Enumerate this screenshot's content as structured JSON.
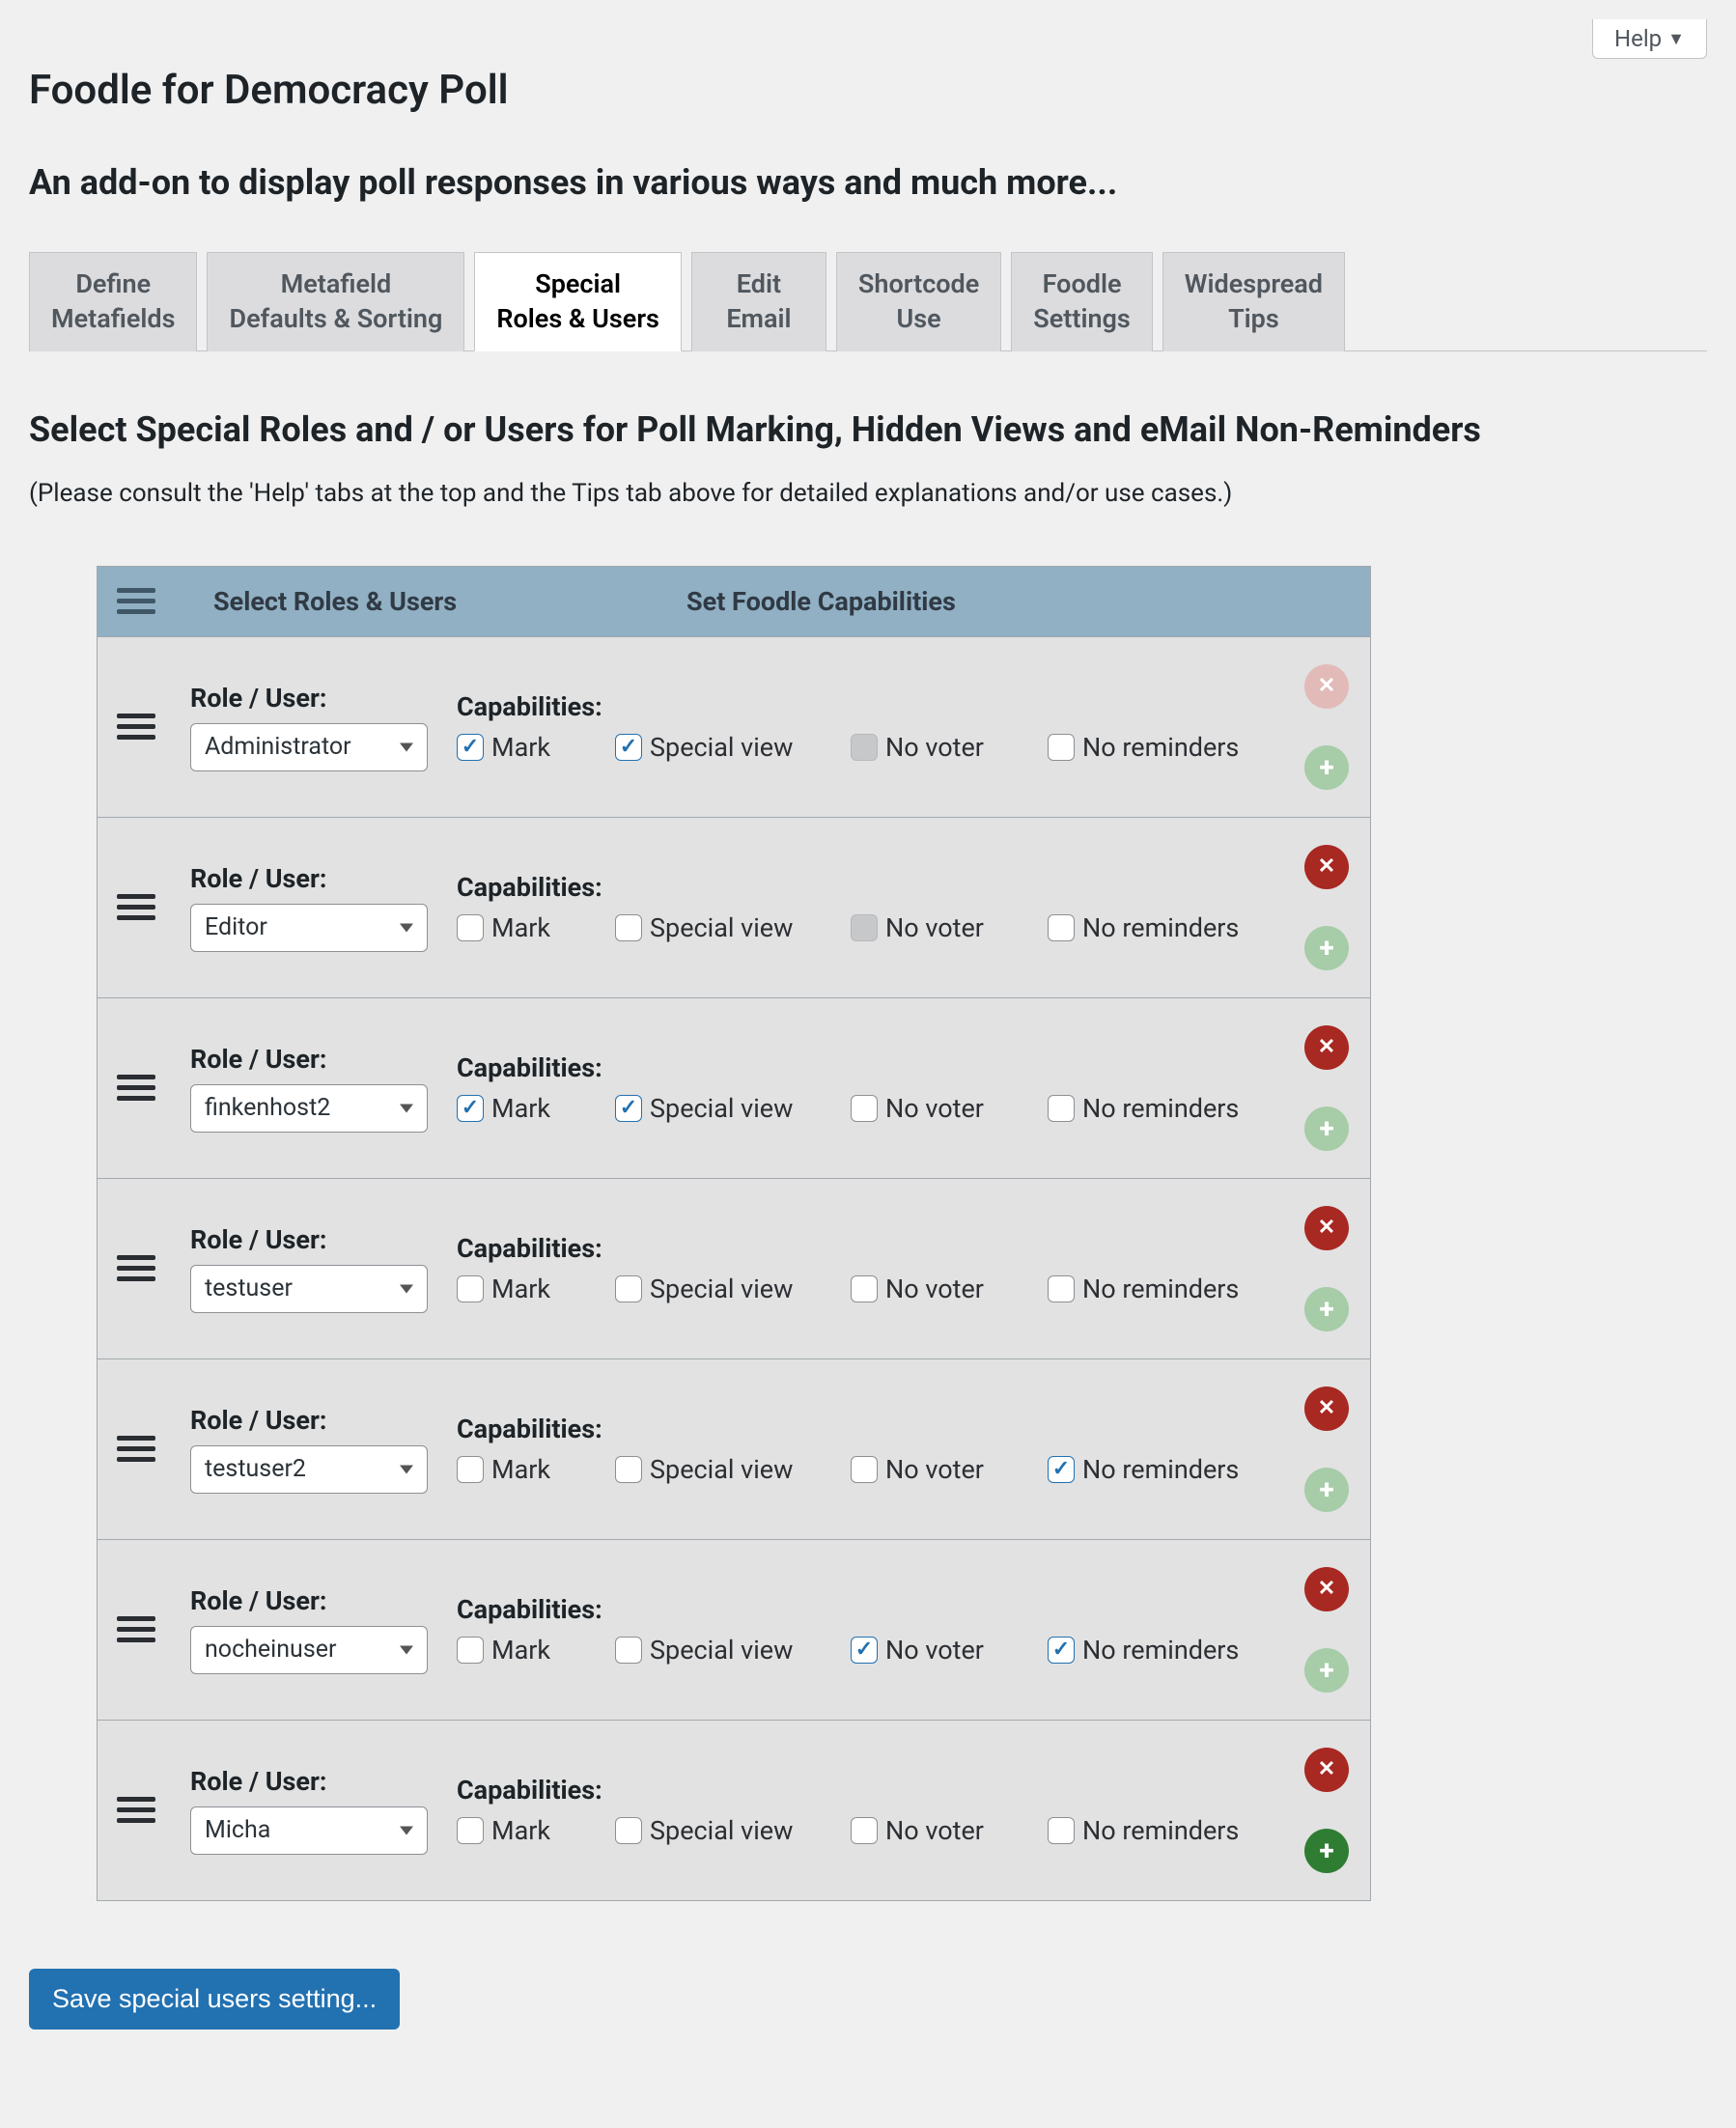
{
  "help": {
    "label": "Help"
  },
  "page": {
    "title": "Foodle for Democracy Poll",
    "subtitle": "An add-on to display poll responses in various ways and much more..."
  },
  "tabs": [
    {
      "lines": [
        "Define",
        "Metafields"
      ],
      "active": false
    },
    {
      "lines": [
        "Metafield",
        "Defaults & Sorting"
      ],
      "active": false
    },
    {
      "lines": [
        "Special",
        "Roles & Users"
      ],
      "active": true
    },
    {
      "lines": [
        "Edit",
        "Email"
      ],
      "active": false
    },
    {
      "lines": [
        "Shortcode",
        "Use"
      ],
      "active": false
    },
    {
      "lines": [
        "Foodle",
        "Settings"
      ],
      "active": false
    },
    {
      "lines": [
        "Widespread",
        "Tips"
      ],
      "active": false
    }
  ],
  "section": {
    "title": "Select Special Roles and / or Users for Poll Marking, Hidden Views and eMail Non-Reminders",
    "note": "(Please consult the 'Help' tabs at the top and the Tips tab above for detailed explanations and/or use cases.)"
  },
  "tableHead": {
    "col1": "Select Roles & Users",
    "col2": "Set Foodle Capabilities"
  },
  "labels": {
    "roleUser": "Role / User:",
    "capabilities": "Capabilities:",
    "mark": "Mark",
    "specialView": "Special view",
    "noVoter": "No voter",
    "noReminders": "No reminders"
  },
  "rows": [
    {
      "value": "Administrator",
      "mark": true,
      "special": true,
      "novoter": false,
      "novoterDisabled": true,
      "norem": false,
      "delDisabled": true,
      "addDisabled": true
    },
    {
      "value": "Editor",
      "mark": false,
      "special": false,
      "novoter": false,
      "novoterDisabled": true,
      "norem": false,
      "delDisabled": false,
      "addDisabled": true
    },
    {
      "value": "finkenhost2",
      "mark": true,
      "special": true,
      "novoter": false,
      "novoterDisabled": false,
      "norem": false,
      "delDisabled": false,
      "addDisabled": true
    },
    {
      "value": "testuser",
      "mark": false,
      "special": false,
      "novoter": false,
      "novoterDisabled": false,
      "norem": false,
      "delDisabled": false,
      "addDisabled": true
    },
    {
      "value": "testuser2",
      "mark": false,
      "special": false,
      "novoter": false,
      "novoterDisabled": false,
      "norem": true,
      "delDisabled": false,
      "addDisabled": true
    },
    {
      "value": "nocheinuser",
      "mark": false,
      "special": false,
      "novoter": true,
      "novoterDisabled": false,
      "norem": true,
      "delDisabled": false,
      "addDisabled": true
    },
    {
      "value": "Micha",
      "mark": false,
      "special": false,
      "novoter": false,
      "novoterDisabled": false,
      "norem": false,
      "delDisabled": false,
      "addDisabled": false
    }
  ],
  "save": {
    "label": "Save special users setting..."
  }
}
